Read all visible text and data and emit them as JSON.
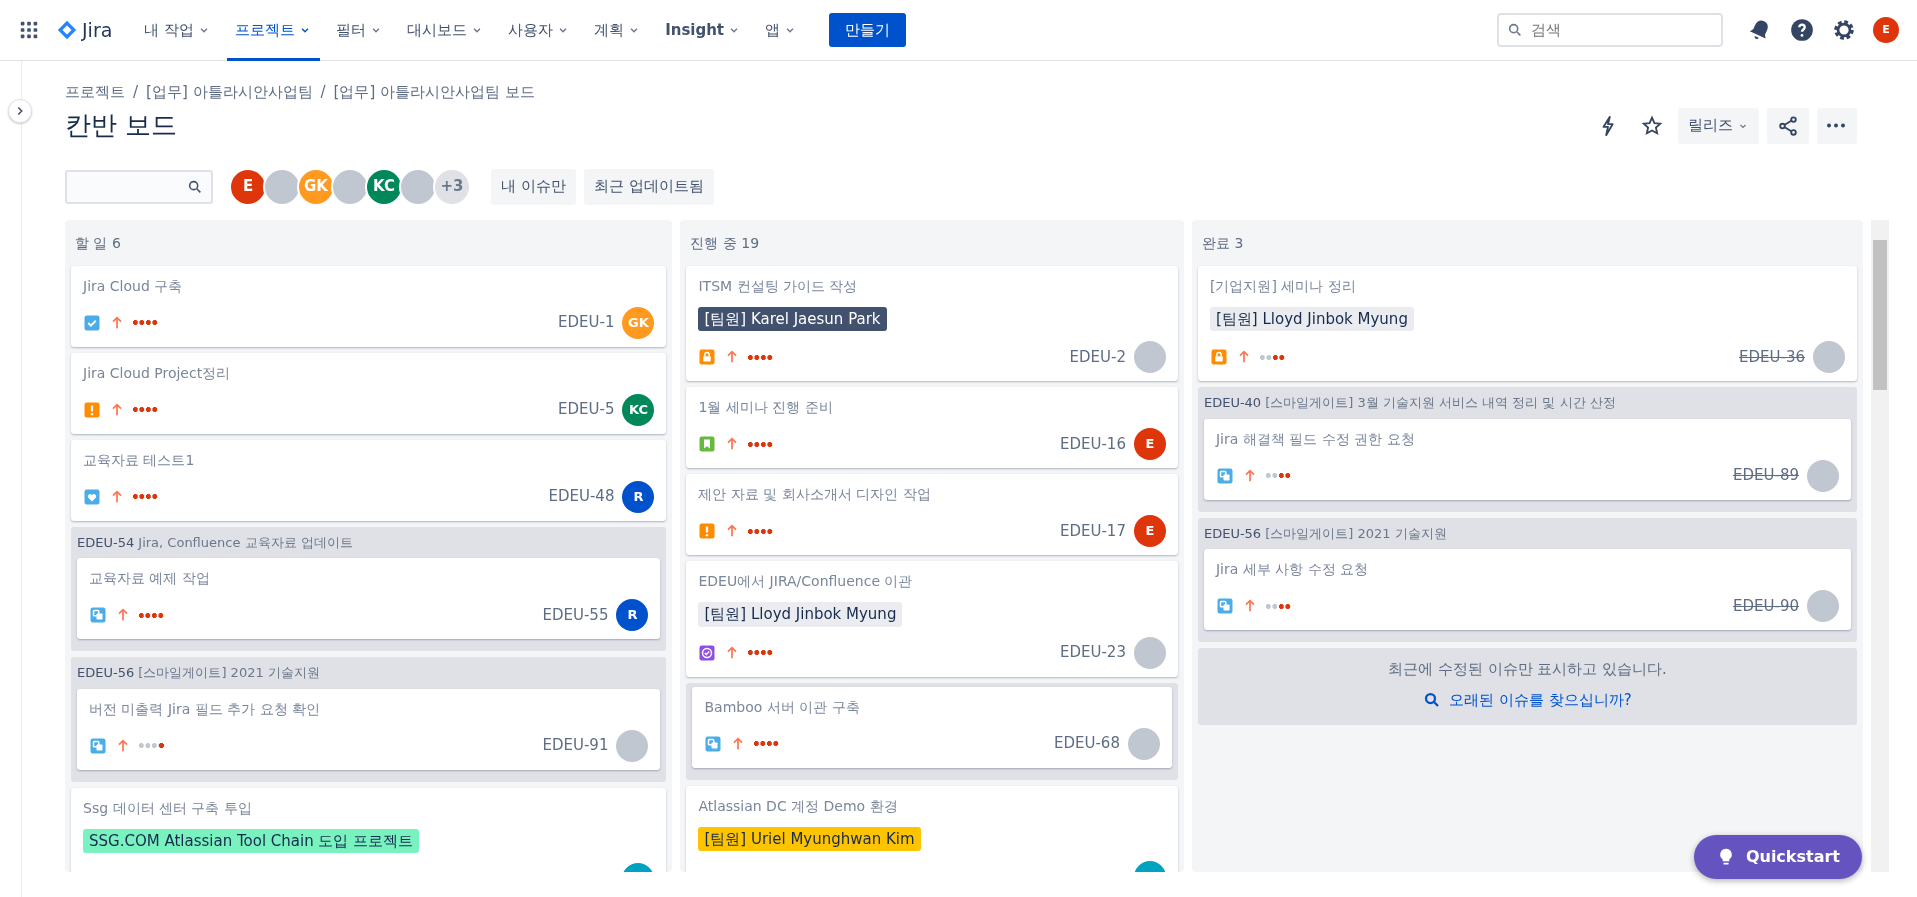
{
  "nav": {
    "items": [
      {
        "label": "내 작업",
        "selected": false,
        "bold": false
      },
      {
        "label": "프로젝트",
        "selected": true,
        "bold": false
      },
      {
        "label": "필터",
        "selected": false,
        "bold": false
      },
      {
        "label": "대시보드",
        "selected": false,
        "bold": false
      },
      {
        "label": "사용자",
        "selected": false,
        "bold": false
      },
      {
        "label": "계획",
        "selected": false,
        "bold": false
      },
      {
        "label": "Insight",
        "selected": false,
        "bold": true
      },
      {
        "label": "앱",
        "selected": false,
        "bold": false
      }
    ],
    "create": "만들기",
    "search": {
      "placeholder": "검색"
    },
    "profile": "E"
  },
  "logo": "Jira",
  "breadcrumbs": [
    "프로젝트",
    "[업무] 아틀라시안사업팀",
    "[업무] 아틀라시안사업팀 보드"
  ],
  "breadcrumb_separators": [
    "/",
    "/"
  ],
  "title": "칸반 보드",
  "release": "릴리즈",
  "filters": {
    "avatars": [
      {
        "kind": "initials",
        "text": "E",
        "color": "#de350b"
      },
      {
        "kind": "image"
      },
      {
        "kind": "initials",
        "text": "GK",
        "color": "#ff991f"
      },
      {
        "kind": "image"
      },
      {
        "kind": "initials",
        "text": "KC",
        "color": "#00875a"
      },
      {
        "kind": "image"
      }
    ],
    "more": "+3",
    "quick_filters": [
      "내 이슈만",
      "최근 업데이트됨"
    ]
  },
  "columns": [
    {
      "name": "할 일",
      "count": "6",
      "items": [
        {
          "kind": "card",
          "title": "Jira Cloud 구축",
          "issue_type": {
            "kind": "task"
          },
          "level": 1,
          "key": "EDEU-1",
          "done": false,
          "assignee": {
            "kind": "initials",
            "text": "GK",
            "color": "#ff991f"
          }
        },
        {
          "kind": "card",
          "title": "Jira Cloud Project정리",
          "issue_type": {
            "kind": "bug"
          },
          "level": 1,
          "key": "EDEU-5",
          "done": false,
          "assignee": {
            "kind": "initials",
            "text": "KC",
            "color": "#00875a"
          }
        },
        {
          "kind": "card",
          "title": "교육자료 테스트1",
          "issue_type": {
            "kind": "heart"
          },
          "level": 1,
          "key": "EDEU-48",
          "done": false,
          "assignee": {
            "kind": "initials",
            "text": "R",
            "color": "#0052cc"
          }
        },
        {
          "kind": "group",
          "key": "EDEU-54",
          "title": "Jira, Confluence 교육자료 업데이트",
          "cards": [
            {
              "kind": "card",
              "title": "교육자료 예제 작업",
              "issue_type": {
                "kind": "subtask"
              },
              "level": 1,
              "key": "EDEU-55",
              "done": false,
              "assignee": {
                "kind": "initials",
                "text": "R",
                "color": "#0052cc"
              }
            }
          ]
        },
        {
          "kind": "group",
          "key": "EDEU-56",
          "title": "[스마일게이트] 2021 기술지원",
          "cards": [
            {
              "kind": "card",
              "title": "버전 미출력 Jira 필드 추가 요청 확인",
              "issue_type": {
                "kind": "subtask"
              },
              "level": 0.25,
              "key": "EDEU-91",
              "done": false,
              "assignee": {
                "kind": "image"
              }
            }
          ]
        },
        {
          "kind": "card",
          "title": "Ssg 데이터 센터 구축 투입",
          "label": {
            "text": "SSG.COM Atlassian Tool Chain 도입 프로젝트",
            "color": "#79f2c0"
          },
          "assignee": {
            "kind": "blank",
            "color": "#00a3bf"
          }
        }
      ]
    },
    {
      "name": "진행 중",
      "count": "19",
      "items": [
        {
          "kind": "card",
          "title": "ITSM 컨설팅 가이드 작성",
          "label": {
            "text": "[팀원] Karel Jaesun Park",
            "color": "#42526e"
          },
          "issue_type": {
            "kind": "lock"
          },
          "level": 1,
          "key": "EDEU-2",
          "done": false,
          "assignee": {
            "kind": "image"
          }
        },
        {
          "kind": "card",
          "title": "1월 세미나 진행 준비",
          "issue_type": {
            "kind": "story"
          },
          "level": 1,
          "key": "EDEU-16",
          "done": false,
          "assignee": {
            "kind": "initials",
            "text": "E",
            "color": "#de350b"
          }
        },
        {
          "kind": "card",
          "title": "제안 자료 및 회사소개서 디자인 작업",
          "issue_type": {
            "kind": "bug"
          },
          "level": 1,
          "key": "EDEU-17",
          "done": false,
          "assignee": {
            "kind": "initials",
            "text": "E",
            "color": "#de350b"
          }
        },
        {
          "kind": "card",
          "title": "EDEU에서 JIRA/Confluence 이관",
          "label": {
            "text": "[팀원] Lloyd Jinbok Myung",
            "color": "#ebecf0"
          },
          "issue_type": {
            "kind": "check"
          },
          "level": 1,
          "key": "EDEU-23",
          "done": false,
          "assignee": {
            "kind": "image"
          }
        },
        {
          "kind": "group",
          "cards": [
            {
              "kind": "card",
              "title": "Bamboo 서버 이관 구축",
              "issue_type": {
                "kind": "subtask"
              },
              "level": 1,
              "key": "EDEU-68",
              "done": false,
              "assignee": {
                "kind": "image"
              }
            }
          ]
        },
        {
          "kind": "card",
          "title": "Atlassian DC 계정 Demo 환경",
          "label": {
            "text": "[팀원] Uriel Myunghwan Kim",
            "color": "#ffc400"
          },
          "assignee": {
            "kind": "blank",
            "color": "#00a3bf"
          }
        }
      ]
    },
    {
      "name": "완료",
      "count": "3",
      "items": [
        {
          "kind": "card",
          "title": "[기업지원] 세미나 정리",
          "label": {
            "text": "[팀원] Lloyd Jinbok Myung",
            "color": "#ebecf0"
          },
          "issue_type": {
            "kind": "lock"
          },
          "level": 0.5,
          "key": "EDEU-36",
          "done": true,
          "assignee": {
            "kind": "image"
          }
        },
        {
          "kind": "group",
          "key": "EDEU-40",
          "title": "[스마일게이트] 3월 기술지원 서비스 내역 정리 및 시간 산정",
          "cards": [
            {
              "kind": "card",
              "title": "Jira 해결책 필드 수정 권한 요청",
              "issue_type": {
                "kind": "subtask"
              },
              "level": 0.5,
              "key": "EDEU-89",
              "done": true,
              "assignee": {
                "kind": "image"
              }
            }
          ]
        },
        {
          "kind": "group",
          "key": "EDEU-56",
          "title": "[스마일게이트] 2021 기술지원",
          "cards": [
            {
              "kind": "card",
              "title": "Jira 세부 사항 수정 요청",
              "issue_type": {
                "kind": "subtask"
              },
              "level": 0.5,
              "key": "EDEU-90",
              "done": true,
              "assignee": {
                "kind": "image"
              }
            }
          ]
        }
      ],
      "footer": {
        "note": "최근에 수정된 이슈만 표시하고 있습니다.",
        "link": "오래된 이슈를 찾으십니까?"
      }
    }
  ],
  "quickstart": "Quickstart"
}
